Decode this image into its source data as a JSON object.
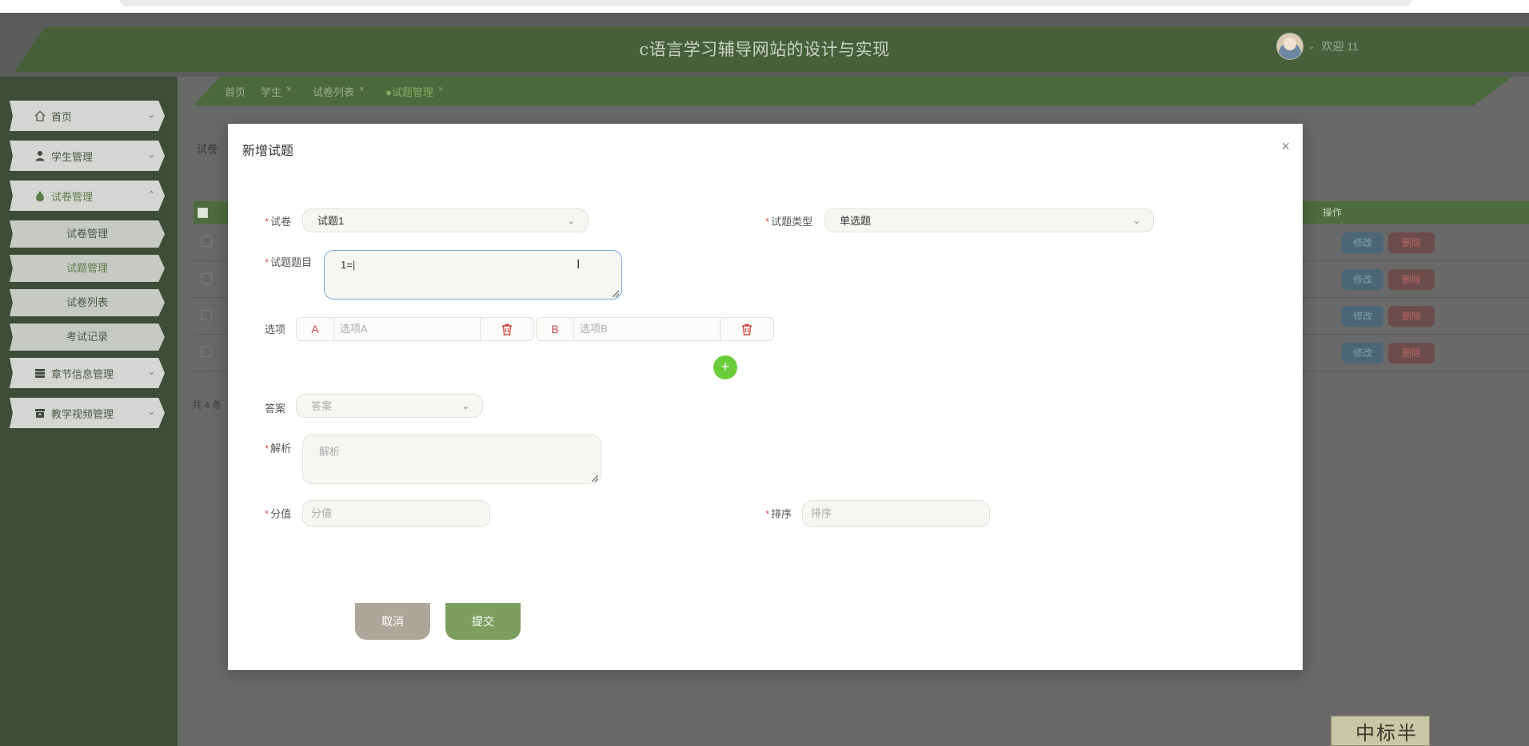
{
  "header": {
    "site_title": "c语言学习辅导网站的设计与实现",
    "welcome": "欢迎 11"
  },
  "sidebar": {
    "items": [
      {
        "label": "首页",
        "icon": "home-icon"
      },
      {
        "label": "学生管理",
        "icon": "user-icon"
      },
      {
        "label": "试卷管理",
        "icon": "drop-icon"
      },
      {
        "label": "章节信息管理",
        "icon": "layers-icon"
      },
      {
        "label": "教学视频管理",
        "icon": "archive-icon"
      }
    ],
    "sub_items": [
      {
        "label": "试卷管理",
        "active": false
      },
      {
        "label": "试题管理",
        "active": true
      },
      {
        "label": "试卷列表",
        "active": false
      },
      {
        "label": "考试记录",
        "active": false
      }
    ]
  },
  "tabs": [
    {
      "label": "首页",
      "closable": false
    },
    {
      "label": "学生",
      "closable": true
    },
    {
      "label": "试卷列表",
      "closable": true
    },
    {
      "label": "试题管理",
      "closable": true,
      "current": true
    }
  ],
  "background": {
    "filter_label": "试卷:",
    "op_header": "操作",
    "edit_label": "修改",
    "delete_label": "删除",
    "row_count": 4,
    "total": "共 4 条",
    "badge_text": "中标半"
  },
  "modal": {
    "title": "新增试题",
    "close": "×",
    "fields": {
      "paper": {
        "label": "试卷",
        "value": "试题1"
      },
      "question_type": {
        "label": "试题类型",
        "value": "单选题"
      },
      "question_title": {
        "label": "试题题目",
        "value": "1="
      },
      "options": {
        "label": "选项",
        "items": [
          {
            "letter": "A",
            "placeholder": "选项A"
          },
          {
            "letter": "B",
            "placeholder": "选项B"
          }
        ]
      },
      "answer": {
        "label": "答案",
        "placeholder": "答案"
      },
      "analysis": {
        "label": "解析",
        "placeholder": "解析"
      },
      "score": {
        "label": "分值",
        "placeholder": "分值"
      },
      "order": {
        "label": "排序",
        "placeholder": "排序"
      }
    },
    "buttons": {
      "cancel": "取消",
      "submit": "提交"
    }
  },
  "colors": {
    "accent": "#7d9e5e",
    "danger": "#d04545",
    "add": "#6bcc3a"
  }
}
